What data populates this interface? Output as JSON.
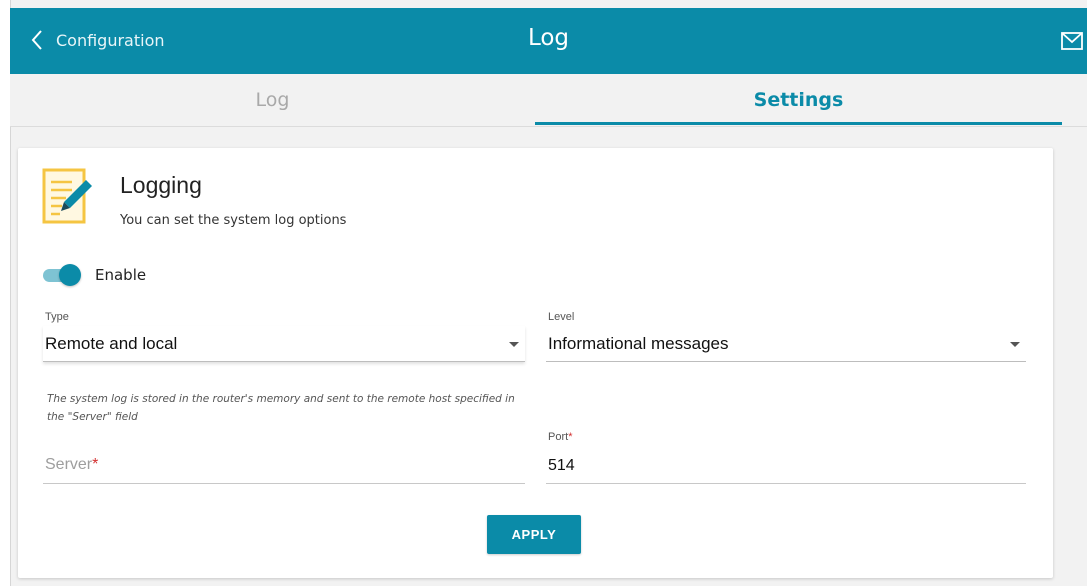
{
  "header": {
    "back_label": "Configuration",
    "title": "Log"
  },
  "tabs": [
    {
      "label": "Log",
      "active": false
    },
    {
      "label": "Settings",
      "active": true
    }
  ],
  "card": {
    "title": "Logging",
    "description": "You can set the system log options",
    "enable": {
      "label": "Enable",
      "checked": true
    },
    "type": {
      "label": "Type",
      "value": "Remote and local"
    },
    "level": {
      "label": "Level",
      "value": "Informational messages"
    },
    "hint": "The system log is stored in the router's memory and sent to the remote host specified in the \"Server\" field",
    "server": {
      "placeholder": "Server",
      "required_mark": "*",
      "value": ""
    },
    "port": {
      "label": "Port",
      "required_mark": "*",
      "value": "514"
    },
    "apply_label": "APPLY"
  },
  "colors": {
    "accent": "#0b8ba8",
    "required": "#d32f2f",
    "icon_yellow": "#f5c542"
  },
  "icons": {
    "back": "chevron-left-icon",
    "mail": "mail-icon",
    "card": "log-edit-icon"
  }
}
